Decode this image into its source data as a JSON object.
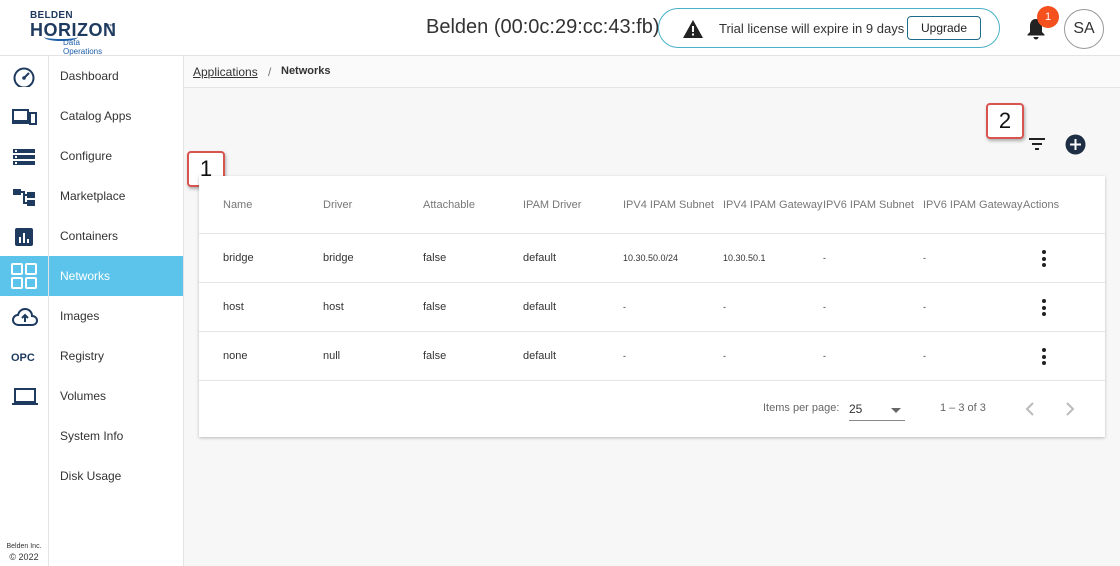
{
  "logo": {
    "line1": "BELDEN",
    "line2": "HORIZON",
    "tm": "™",
    "line3": "Data Operations"
  },
  "header": {
    "device_title": "Belden (00:0c:29:cc:43:fb)",
    "license_text": "Trial license will expire in 9 days",
    "upgrade_label": "Upgrade",
    "notification_count": "1",
    "avatar_initials": "SA"
  },
  "rail": {
    "opc_label": "OPC",
    "footer_company": "Belden Inc.",
    "footer_year": "© 2022"
  },
  "nav": {
    "items": [
      {
        "label": "Dashboard"
      },
      {
        "label": "Catalog Apps"
      },
      {
        "label": "Configure"
      },
      {
        "label": "Marketplace"
      },
      {
        "label": "Containers"
      },
      {
        "label": "Networks"
      },
      {
        "label": "Images"
      },
      {
        "label": "Registry"
      },
      {
        "label": "Volumes"
      },
      {
        "label": "System Info"
      },
      {
        "label": "Disk Usage"
      }
    ],
    "active": "Networks"
  },
  "breadcrumb": {
    "parent": "Applications",
    "separator": "/",
    "current": "Networks"
  },
  "callouts": {
    "one": "1",
    "two": "2"
  },
  "table": {
    "columns": [
      "Name",
      "Driver",
      "Attachable",
      "IPAM Driver",
      "IPV4 IPAM Subnet",
      "IPV4 IPAM Gateway",
      "IPV6 IPAM Subnet",
      "IPV6 IPAM Gateway",
      "Actions"
    ],
    "rows": [
      [
        "bridge",
        "bridge",
        "false",
        "default",
        "10.30.50.0/24",
        "10.30.50.1",
        "-",
        "-"
      ],
      [
        "host",
        "host",
        "false",
        "default",
        "-",
        "-",
        "-",
        "-"
      ],
      [
        "none",
        "null",
        "false",
        "default",
        "-",
        "-",
        "-",
        "-"
      ]
    ]
  },
  "paginator": {
    "items_per_page_label": "Items per page:",
    "items_per_page_value": "25",
    "range_label": "1 – 3 of 3"
  },
  "colors": {
    "accent": "#5cc4ea",
    "brand": "#1e3a5f",
    "badge": "#f4511e",
    "callout_border": "#d9534f"
  },
  "icons": [
    "dashboard-gauge-icon",
    "devices-icon",
    "configure-list-icon",
    "marketplace-tree-icon",
    "containers-chart-icon",
    "networks-grid-icon",
    "cloud-upload-icon",
    "laptop-icon",
    "warning-icon",
    "bell-icon",
    "filter-icon",
    "add-circle-icon",
    "kebab-menu-icon",
    "chevron-left-icon",
    "chevron-right-icon",
    "dropdown-arrow-icon"
  ]
}
